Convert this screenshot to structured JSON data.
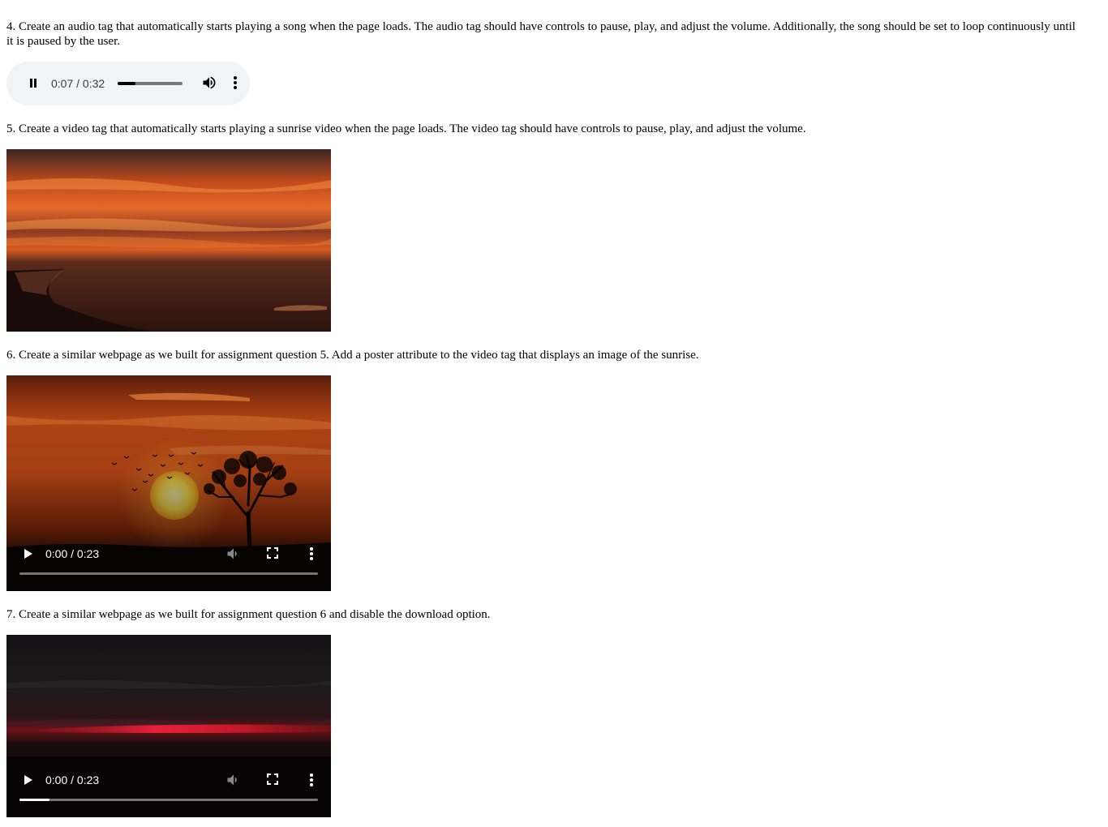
{
  "questions": {
    "q4": "4. Create an audio tag that automatically starts playing a song when the page loads. The audio tag should have controls to pause, play, and adjust the volume. Additionally, the song should be set to loop continuously until it is paused by the user.",
    "q5": "5. Create a video tag that automatically starts playing a sunrise video when the page loads. The video tag should have controls to pause, play, and adjust the volume.",
    "q6": "6. Create a similar webpage as we built for assignment question 5. Add a poster attribute to the video tag that displays an image of the sunrise.",
    "q7": "7. Create a similar webpage as we built for assignment question 6 and disable the download option."
  },
  "audio_player": {
    "state": "playing",
    "time": "0:07 / 0:32",
    "progress": 0.27
  },
  "video_q6": {
    "time": "0:00 / 0:23",
    "progress": 0
  },
  "video_q7": {
    "time": "0:00 / 0:23",
    "progress": 0.1
  },
  "colors": {
    "audio_bg": "#f1f3f4",
    "sky_orange": "#e0561a",
    "sun_yellow": "#ffe14a"
  }
}
